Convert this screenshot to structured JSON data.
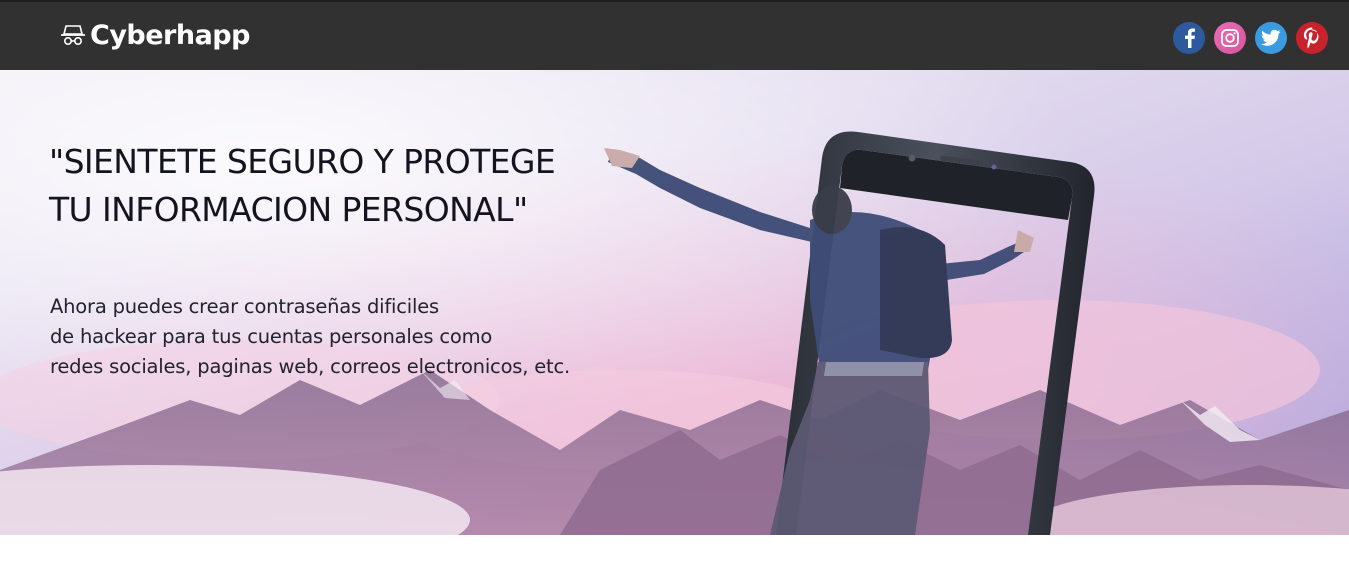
{
  "header": {
    "brand": "Cyberhapp",
    "logo_icon": "hacker-hat-icon",
    "social": [
      {
        "name": "facebook",
        "icon": "facebook-icon",
        "color": "#2d5a9e"
      },
      {
        "name": "instagram",
        "icon": "instagram-icon",
        "color": "#e86db6"
      },
      {
        "name": "twitter",
        "icon": "twitter-icon",
        "color": "#3a9be0"
      },
      {
        "name": "pinterest",
        "icon": "pinterest-icon",
        "color": "#c8232c"
      }
    ]
  },
  "hero": {
    "headline": [
      "\"SIENTETE SEGURO Y PROTEGE",
      "TU INFORMACION PERSONAL\""
    ],
    "subtext": [
      "Ahora puedes crear contraseñas dificiles",
      "de hackear para tus cuentas personales como",
      "redes sociales, paginas web, correos electronicos, etc."
    ],
    "image": "man-jumping-out-of-phone-over-mountains"
  },
  "colors": {
    "header_bg": "#313131",
    "text_dark": "#141420"
  }
}
